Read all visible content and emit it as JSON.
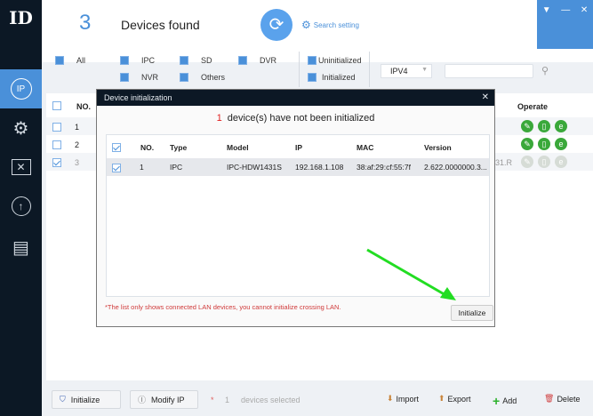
{
  "sidebar": {
    "items": [
      {
        "name": "logo",
        "glyph": "ID"
      },
      {
        "name": "ip",
        "glyph": "IP"
      },
      {
        "name": "camera-config"
      },
      {
        "name": "tools"
      },
      {
        "name": "upgrade"
      },
      {
        "name": "docs"
      }
    ]
  },
  "header": {
    "count": "3",
    "title": "Devices found",
    "search_setting": "Search setting"
  },
  "filters": {
    "all": "All",
    "ipc": "IPC",
    "sd": "SD",
    "dvr": "DVR",
    "nvr": "NVR",
    "others": "Others",
    "uninitialized": "Uninitialized",
    "initialized": "Initialized",
    "protocol": "IPV4",
    "search_value": ""
  },
  "table": {
    "col_no": "NO.",
    "col_operate": "Operate",
    "rows": [
      {
        "no": "1",
        "checked": false
      },
      {
        "no": "2",
        "checked": false
      },
      {
        "no": "3",
        "checked": true,
        "fragment": "31.R"
      }
    ]
  },
  "dialog": {
    "title": "Device initialization",
    "count": "1",
    "message": "device(s) have not been initialized",
    "columns": [
      "NO.",
      "Type",
      "Model",
      "IP",
      "MAC",
      "Version"
    ],
    "rows": [
      {
        "no": "1",
        "type": "IPC",
        "model": "IPC-HDW1431S",
        "ip": "192.168.1.108",
        "mac": "38:af:29:cf:55:7f",
        "version": "2.622.0000000.3...",
        "checked": true
      }
    ],
    "note": "*The list only shows connected LAN devices, you cannot initialize crossing LAN.",
    "initialize": "Initialize"
  },
  "bottom": {
    "initialize": "Initialize",
    "modify_ip": "Modify IP",
    "star": "*",
    "selected_count": "1",
    "selected_label": "devices selected",
    "import": "Import",
    "export": "Export",
    "add": "Add",
    "delete": "Delete"
  },
  "colors": {
    "accent": "#4a90d9",
    "sidebar": "#0c1825",
    "operate": "#3aa83a",
    "arrow": "#22dd22"
  }
}
